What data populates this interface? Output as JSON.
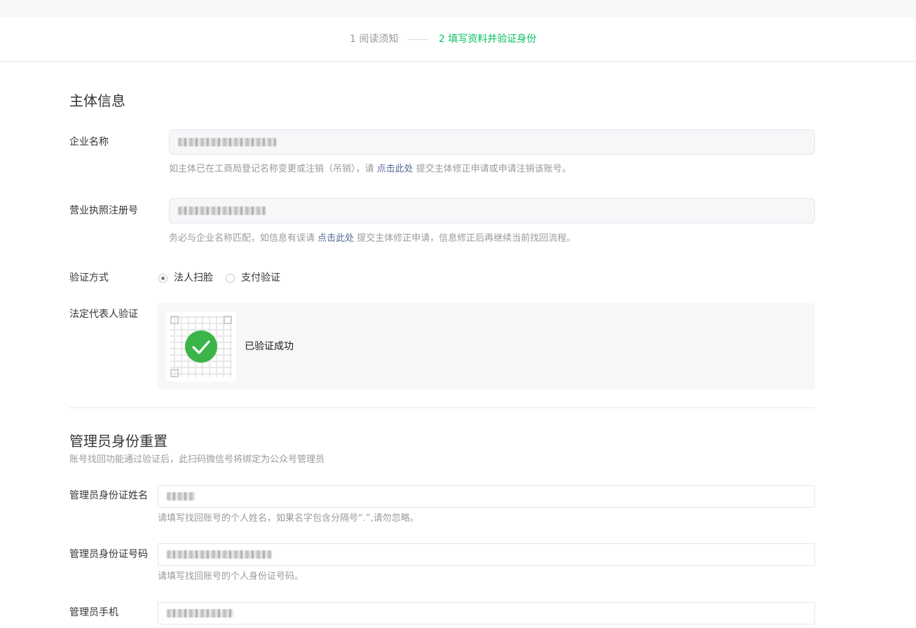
{
  "steps": {
    "step1": "1 阅读须知",
    "step2": "2 填写资料并验证身份"
  },
  "colors": {
    "accent_green": "#07c160",
    "link_blue": "#576b95",
    "success_green": "#3bb54a"
  },
  "entity_section": {
    "title": "主体信息",
    "company_name": {
      "label": "企业名称",
      "hint_before": "如主体已在工商局登记名称变更或注销（吊销），请 ",
      "hint_link": "点击此处",
      "hint_after": " 提交主体修正申请或申请注销该账号。"
    },
    "license_number": {
      "label": "营业执照注册号",
      "hint_before": "务必与企业名称匹配，如信息有误请 ",
      "hint_link": "点击此处",
      "hint_after": " 提交主体修正申请，信息修正后再继续当前找回流程。"
    },
    "verify_method": {
      "label": "验证方式",
      "options": [
        "法人扫脸",
        "支付验证"
      ],
      "selected": "法人扫脸"
    },
    "legal_rep": {
      "label": "法定代表人验证",
      "status": "已验证成功",
      "qr_icon": "qr-code-icon",
      "check_icon": "check-circle-icon"
    }
  },
  "admin_section": {
    "title": "管理员身份重置",
    "subtitle": "账号找回功能通过验证后，此扫码微信号将绑定为公众号管理员",
    "name": {
      "label": "管理员身份证姓名",
      "hint": "请填写找回账号的个人姓名，如果名字包含分隔号“.”,请勿忽略。"
    },
    "id_number": {
      "label": "管理员身份证号码",
      "hint": "请填写找回账号的个人身份证号码。"
    },
    "phone": {
      "label": "管理员手机"
    }
  }
}
